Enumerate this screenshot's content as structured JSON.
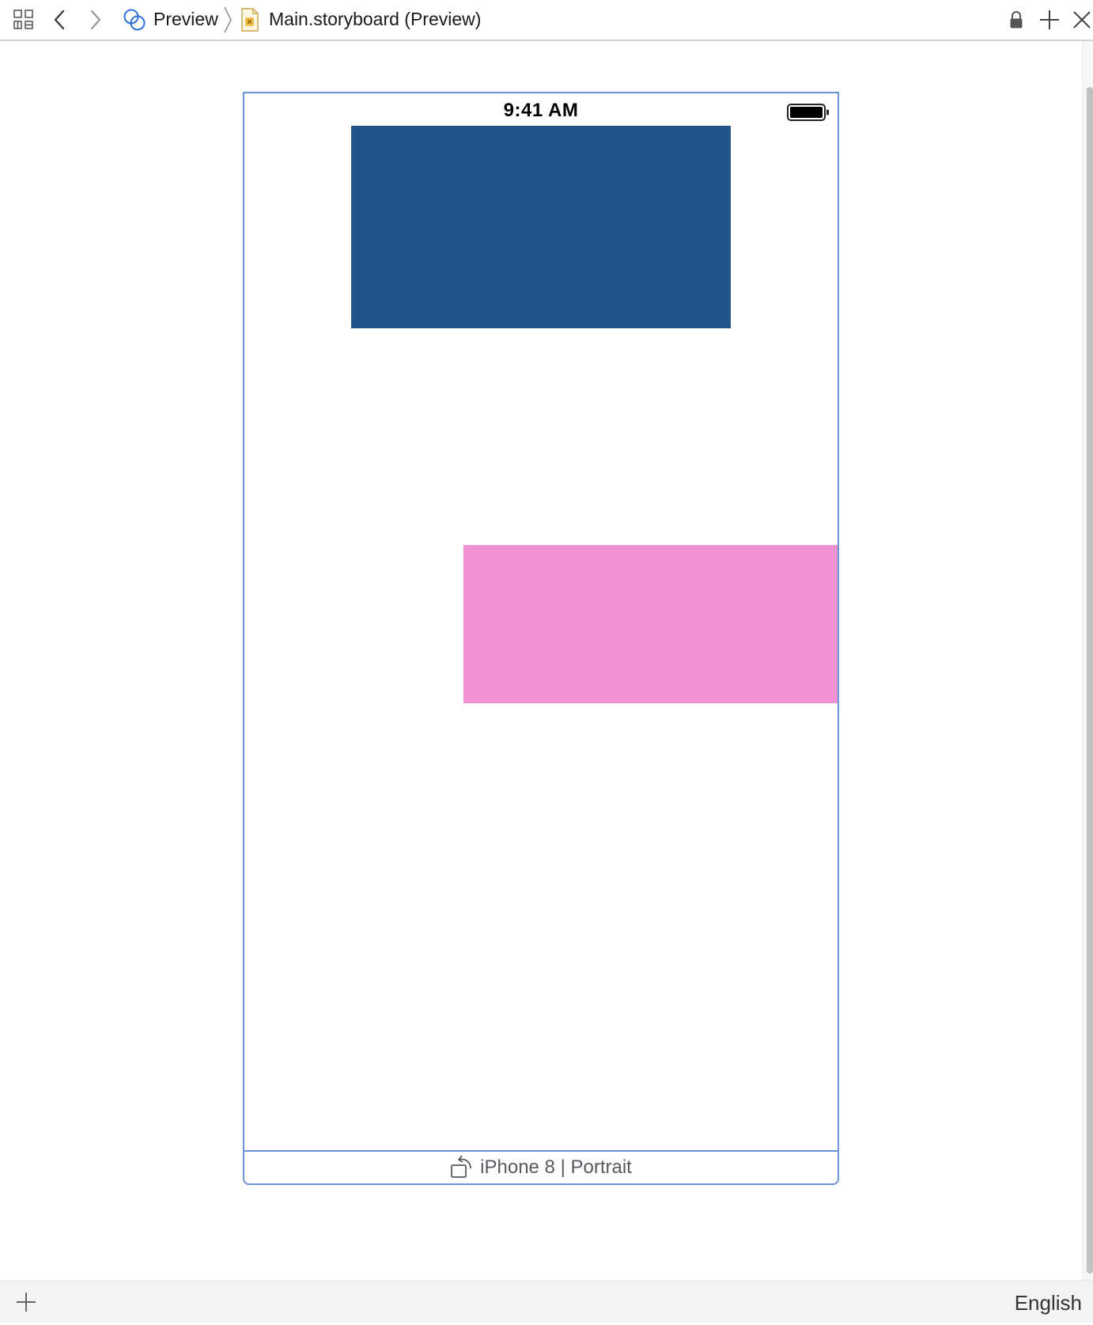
{
  "jumpbar": {
    "related_items_icon": "grid-icon",
    "back_icon": "chevron-left-icon",
    "forward_icon": "chevron-right-icon",
    "preview_icon": "linked-circles-icon",
    "crumb_preview": "Preview",
    "separator_icon": "chevron-right-thin-icon",
    "file_icon": "storyboard-file-icon",
    "crumb_file": "Main.storyboard (Preview)",
    "lock_icon": "lock-icon",
    "add_icon": "plus-icon",
    "close_icon": "close-icon"
  },
  "device": {
    "status_time": "9:41 AM",
    "battery_icon": "battery-icon",
    "rotate_icon": "rotate-device-icon",
    "label": "iPhone 8 | Portrait"
  },
  "views": {
    "blue_color": "#22548c",
    "pink_color": "#ef91d3"
  },
  "bottombar": {
    "add_icon": "plus-icon",
    "language": "English"
  },
  "colors": {
    "frame_border": "#6d95d6",
    "preview_icon_blue": "#2e72d6"
  }
}
